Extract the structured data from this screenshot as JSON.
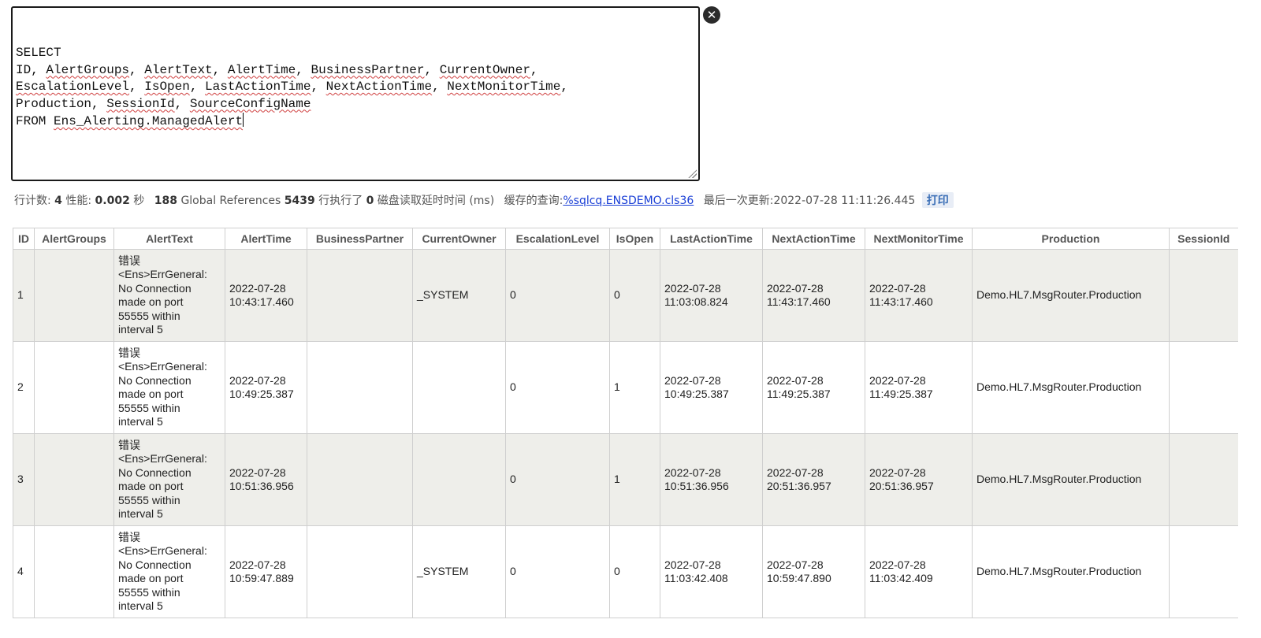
{
  "editor": {
    "lines": [
      [
        {
          "t": "SELECT"
        }
      ],
      [
        {
          "t": "ID, "
        },
        {
          "t": "AlertGroups",
          "s": 1
        },
        {
          "t": ", "
        },
        {
          "t": "AlertText",
          "s": 1
        },
        {
          "t": ", "
        },
        {
          "t": "AlertTime",
          "s": 1
        },
        {
          "t": ", "
        },
        {
          "t": "BusinessPartner",
          "s": 1
        },
        {
          "t": ", "
        },
        {
          "t": "CurrentOwner",
          "s": 1
        },
        {
          "t": ","
        }
      ],
      [
        {
          "t": "EscalationLevel",
          "s": 1
        },
        {
          "t": ", "
        },
        {
          "t": "IsOpen",
          "s": 1
        },
        {
          "t": ", "
        },
        {
          "t": "LastActionTime",
          "s": 1
        },
        {
          "t": ", "
        },
        {
          "t": "NextActionTime",
          "s": 1
        },
        {
          "t": ", "
        },
        {
          "t": "NextMonitorTime",
          "s": 1
        },
        {
          "t": ","
        }
      ],
      [
        {
          "t": "Production, "
        },
        {
          "t": "SessionId",
          "s": 1
        },
        {
          "t": ", "
        },
        {
          "t": "SourceConfigName",
          "s": 1
        }
      ],
      [
        {
          "t": "FROM "
        },
        {
          "t": "Ens_Alerting.ManagedAlert",
          "s": 1
        }
      ]
    ],
    "clear_icon": "close-circle-icon",
    "clear_glyph": "✕"
  },
  "stats": {
    "rows_label": "行计数:",
    "rows_value": "4",
    "perf_label": "性能:",
    "perf_value": "0.002",
    "perf_unit": "秒",
    "global_refs_value": "188",
    "global_refs_label": "Global References",
    "lines_exec_value": "5439",
    "lines_exec_label": "行执行了",
    "disk_value": "0",
    "disk_label": "磁盘读取延时时间 (ms)",
    "cached_label": "缓存的查询:",
    "cached_link": "%sqlcq.ENSDEMO.cls36",
    "updated_label": "最后一次更新:",
    "updated_value": "2022-07-28 11:11:26.445",
    "print_label": "打印"
  },
  "table": {
    "columns": [
      "ID",
      "AlertGroups",
      "AlertText",
      "AlertTime",
      "BusinessPartner",
      "CurrentOwner",
      "EscalationLevel",
      "IsOpen",
      "LastActionTime",
      "NextActionTime",
      "NextMonitorTime",
      "Production",
      "SessionId"
    ],
    "rows": [
      {
        "ID": "1",
        "AlertGroups": "",
        "AlertText": "错误\n<Ens>ErrGeneral:\nNo Connection\nmade on port\n55555 within\ninterval 5",
        "AlertTime": "2022-07-28\n10:43:17.460",
        "BusinessPartner": "",
        "CurrentOwner": "_SYSTEM",
        "EscalationLevel": "0",
        "IsOpen": "0",
        "LastActionTime": "2022-07-28\n11:03:08.824",
        "NextActionTime": "2022-07-28\n11:43:17.460",
        "NextMonitorTime": "2022-07-28\n11:43:17.460",
        "Production": "Demo.HL7.MsgRouter.Production",
        "SessionId": ""
      },
      {
        "ID": "2",
        "AlertGroups": "",
        "AlertText": "错误\n<Ens>ErrGeneral:\nNo Connection\nmade on port\n55555 within\ninterval 5",
        "AlertTime": "2022-07-28\n10:49:25.387",
        "BusinessPartner": "",
        "CurrentOwner": "",
        "EscalationLevel": "0",
        "IsOpen": "1",
        "LastActionTime": "2022-07-28\n10:49:25.387",
        "NextActionTime": "2022-07-28\n11:49:25.387",
        "NextMonitorTime": "2022-07-28\n11:49:25.387",
        "Production": "Demo.HL7.MsgRouter.Production",
        "SessionId": ""
      },
      {
        "ID": "3",
        "AlertGroups": "",
        "AlertText": "错误\n<Ens>ErrGeneral:\nNo Connection\nmade on port\n55555 within\ninterval 5",
        "AlertTime": "2022-07-28\n10:51:36.956",
        "BusinessPartner": "",
        "CurrentOwner": "",
        "EscalationLevel": "0",
        "IsOpen": "1",
        "LastActionTime": "2022-07-28\n10:51:36.956",
        "NextActionTime": "2022-07-28\n20:51:36.957",
        "NextMonitorTime": "2022-07-28\n20:51:36.957",
        "Production": "Demo.HL7.MsgRouter.Production",
        "SessionId": ""
      },
      {
        "ID": "4",
        "AlertGroups": "",
        "AlertText": "错误\n<Ens>ErrGeneral:\nNo Connection\nmade on port\n55555 within\ninterval 5",
        "AlertTime": "2022-07-28\n10:59:47.889",
        "BusinessPartner": "",
        "CurrentOwner": "_SYSTEM",
        "EscalationLevel": "0",
        "IsOpen": "0",
        "LastActionTime": "2022-07-28\n11:03:42.408",
        "NextActionTime": "2022-07-28\n10:59:47.890",
        "NextMonitorTime": "2022-07-28\n11:03:42.409",
        "Production": "Demo.HL7.MsgRouter.Production",
        "SessionId": ""
      }
    ]
  }
}
